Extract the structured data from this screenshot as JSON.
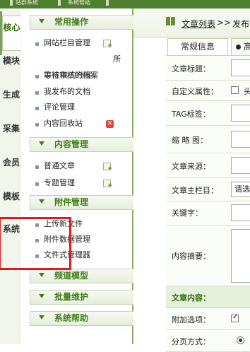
{
  "topbar": {
    "item1": "站群系统",
    "item2": "系统帮助"
  },
  "vtabs": [
    {
      "label": "核心",
      "active": true
    },
    {
      "label": "模块"
    },
    {
      "label": "生成"
    },
    {
      "label": "采集"
    },
    {
      "label": "会员"
    },
    {
      "label": "模板"
    },
    {
      "label": "系统"
    }
  ],
  "menu": {
    "sections": [
      {
        "label": "常用操作"
      },
      {
        "label": "内容管理"
      },
      {
        "label": "附件管理"
      },
      {
        "label": "频道模型"
      },
      {
        "label": "批量维护"
      },
      {
        "label": "系统帮助"
      }
    ],
    "common": {
      "item1": "网站栏目管理",
      "overlay": "所",
      "item2a": "等待审核的档案",
      "item2b": "审核稿的档案",
      "item3": "我发布的文档",
      "item4": "评论管理",
      "item5": "内容回收站"
    },
    "content": {
      "item1": "普通文章",
      "item2": "专题管理"
    },
    "attach": {
      "item1": "上传新文件",
      "item2": "附件数据管理",
      "item3": "文件式管理器"
    }
  },
  "main": {
    "crumb1": "文章列表",
    "crumb_sep": ">>",
    "crumb2": "发布",
    "tab1": "常规信息",
    "tab2": "高",
    "form": {
      "title_label": "文章标题：",
      "custom_label": "自定义属性：",
      "custom_opt": "头",
      "tag_label": "TAG标签：",
      "thumb_label": "缩 略 图：",
      "source_label": "文章来源：",
      "column_label": "文章主栏目：",
      "column_value": "请选",
      "keywords_label": "关键字：",
      "summary_label": "内容摘要：",
      "content_header": "文章内容：",
      "extra_label": "附加选项：",
      "pagination_label": "分页方式："
    }
  }
}
